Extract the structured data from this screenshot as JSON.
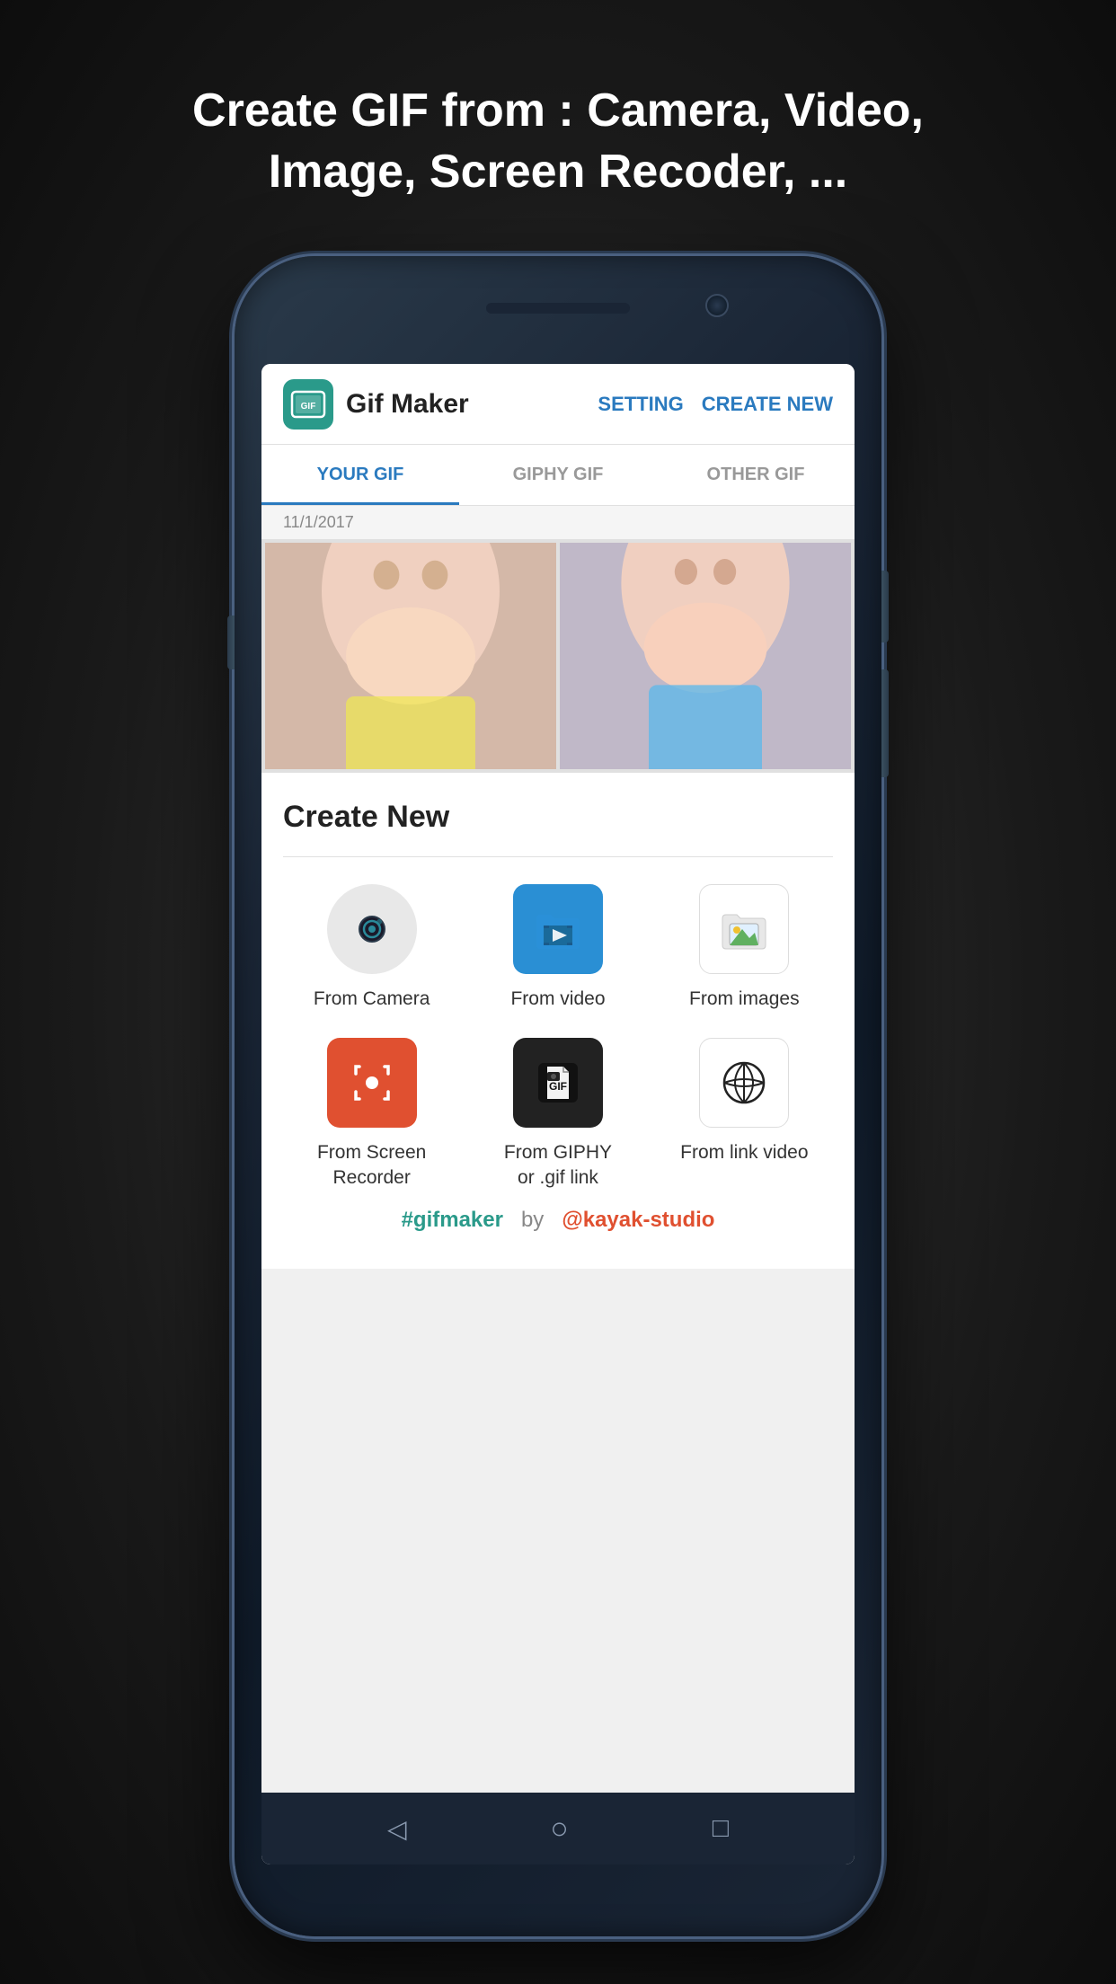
{
  "headline": {
    "line1": "Create GIF from : ",
    "line1_bold": "Camera, Video,",
    "line2_bold": "Image, Screen Recoder, ..."
  },
  "app": {
    "logo_text": "GIF",
    "title": "Gif Maker",
    "setting_label": "SETTING",
    "create_new_label": "CREATE NEW"
  },
  "tabs": [
    {
      "label": "YOUR GIF",
      "active": true
    },
    {
      "label": "GIPHY GIF",
      "active": false
    },
    {
      "label": "OTHER GIF",
      "active": false
    }
  ],
  "date_label": "11/1/2017",
  "create_panel": {
    "title": "Create New"
  },
  "create_items": [
    {
      "id": "camera",
      "label": "From Camera"
    },
    {
      "id": "video",
      "label": "From video"
    },
    {
      "id": "images",
      "label": "From images"
    },
    {
      "id": "screen",
      "label": "From Screen\nRecorder"
    },
    {
      "id": "giphy",
      "label": "From GIPHY\nor .gif link"
    },
    {
      "id": "link",
      "label": "From link video"
    }
  ],
  "footer": {
    "hashtag": "#gifmaker",
    "by": "by",
    "studio": "@kayak-studio"
  },
  "nav": {
    "back": "◁",
    "home": "○",
    "recent": "□"
  }
}
